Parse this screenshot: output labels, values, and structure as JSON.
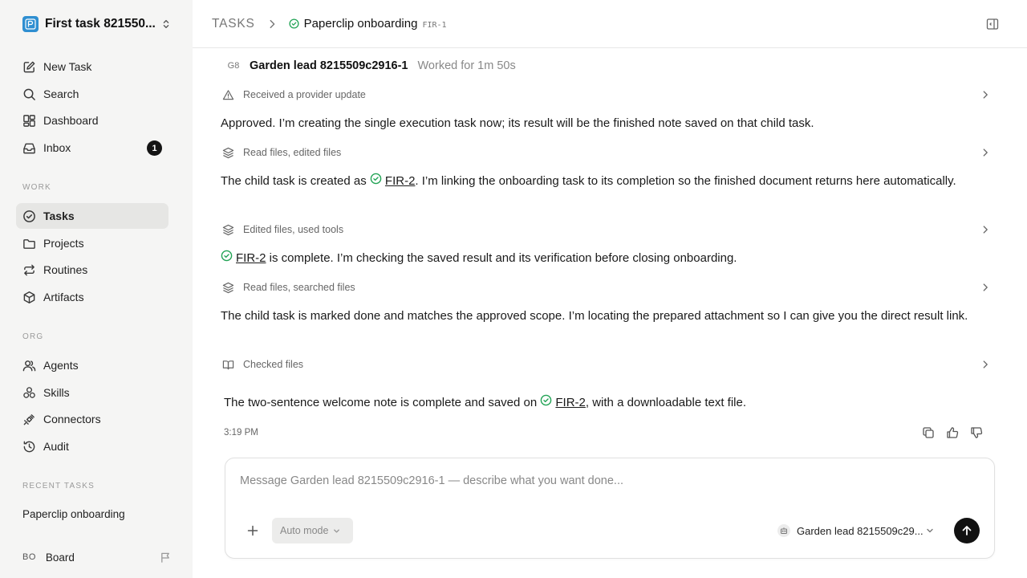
{
  "workspace": {
    "name": "First task 821550...",
    "logo_color": "#2f8fd1"
  },
  "nav": {
    "new_task": "New Task",
    "search": "Search",
    "dashboard": "Dashboard",
    "inbox": "Inbox",
    "inbox_count": "1"
  },
  "sections": {
    "work": "WORK",
    "org": "ORG",
    "recent": "RECENT TASKS"
  },
  "work_nav": {
    "tasks": "Tasks",
    "projects": "Projects",
    "routines": "Routines",
    "artifacts": "Artifacts"
  },
  "org_nav": {
    "agents": "Agents",
    "skills": "Skills",
    "connectors": "Connectors",
    "audit": "Audit"
  },
  "recent": {
    "item": "Paperclip onboarding"
  },
  "user": {
    "initials": "BO",
    "name": "Board"
  },
  "header": {
    "root": "TASKS",
    "title": "Paperclip onboarding",
    "task_id": "FIR-1"
  },
  "thread": {
    "agent_initials": "G8",
    "agent_name": "Garden lead 8215509c2916-1",
    "worked_for": "Worked for 1m 50s",
    "act1": "Received a provider update",
    "msg1": "Approved. I’m creating the single execution task now; its result will be the finished note saved on that child task.",
    "act2": "Read files, edited files",
    "msg2_pre": "The child task is created as ",
    "msg2_ref": "FIR-2",
    "msg2_post": ". I’m linking the onboarding task to its completion so the finished document returns here automatically.",
    "act3": "Edited files, used tools",
    "msg3_ref": "FIR-2",
    "msg3_post": " is complete. I’m checking the saved result and its verification before closing onboarding.",
    "act4": "Read files, searched files",
    "msg4": "The child task is marked done and matches the approved scope. I’m locating the prepared attachment so I can give you the direct result link.",
    "act5": "Checked files",
    "final_pre": "The two-sentence welcome note is complete and saved on ",
    "final_ref": "FIR-2",
    "final_post": ", with a downloadable text file.",
    "timestamp": "3:19 PM"
  },
  "composer": {
    "placeholder": "Message Garden lead 8215509c2916-1 — describe what you want done...",
    "mode": "Auto mode",
    "agent": "Garden lead 8215509c29..."
  },
  "colors": {
    "accent_green": "#22a355",
    "send_bg": "#121212",
    "sidebar_bg": "#f5f5f4"
  }
}
